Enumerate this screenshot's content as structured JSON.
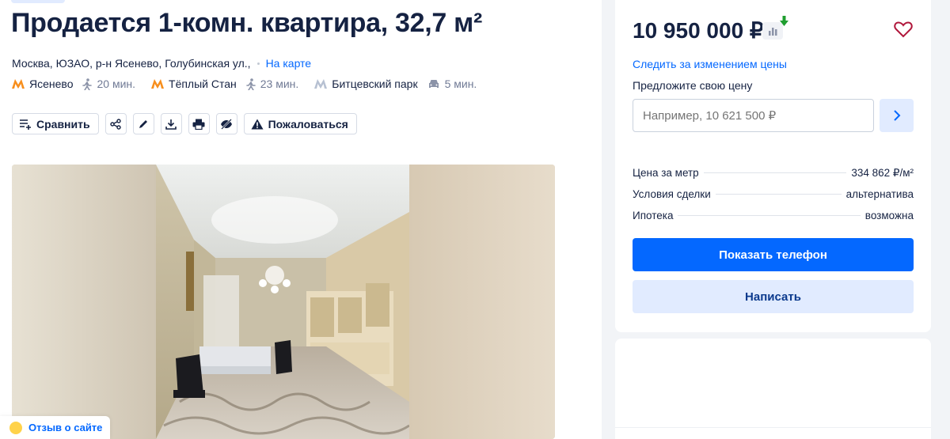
{
  "listing": {
    "title": "Продается 1-комн. квартира, 32,7 м²",
    "address": "Москва, ЮЗАО, р-н Ясенево, Голубинская ул.,",
    "map_link": "На карте",
    "metro": [
      {
        "name": "Ясенево",
        "time": "20 мин.",
        "mode": "walk-icon"
      },
      {
        "name": "Тёплый Стан",
        "time": "23 мин.",
        "mode": "walk-icon"
      },
      {
        "name": "Битцевский парк",
        "time": "5 мин.",
        "mode": "car-icon"
      }
    ],
    "metro_color_primary": "#f78f1e",
    "metro_color_secondary": "#b7c1d2"
  },
  "actions": {
    "compare_label": "Сравнить",
    "complain_label": "Пожаловаться"
  },
  "sidebar": {
    "price": "10 950 000 ₽",
    "follow_price": "Следить за изменением цены",
    "offer_label": "Предложите свою цену",
    "offer_placeholder": "Например, 10 621 500 ₽",
    "facts": [
      {
        "label": "Цена за метр",
        "value": "334 862 ₽/м²"
      },
      {
        "label": "Условия сделки",
        "value": "альтернатива"
      },
      {
        "label": "Ипотека",
        "value": "возможна"
      }
    ],
    "show_phone": "Показать телефон",
    "write": "Написать"
  },
  "feedback": {
    "label": "Отзыв о сайте"
  },
  "colors": {
    "accent": "#0468ff",
    "accent_light": "#e1ebff",
    "text": "#152242",
    "price_down": "#1f9e2f"
  }
}
